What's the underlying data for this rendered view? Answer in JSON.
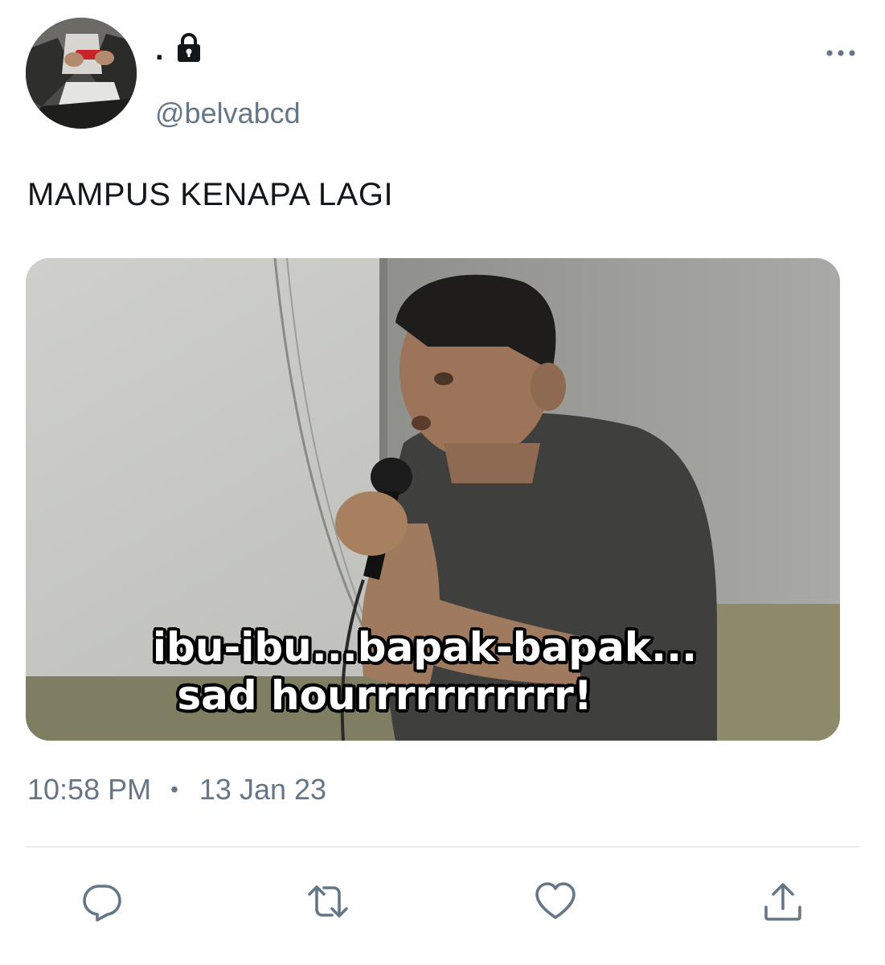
{
  "tweet": {
    "display_name": ".",
    "username": "@belvabcd",
    "text": "MAMPUS KENAPA LAGI",
    "time": "10:58 PM",
    "separator": "•",
    "date": "13 Jan 23",
    "media": {
      "caption_line1": "ibu-ibu...bapak-bapak...",
      "caption_line2": "sad hourrrrrrrrrrr!"
    }
  },
  "icons": {
    "lock": "lock-icon",
    "more": "more-horizontal-icon",
    "reply": "reply-icon",
    "retweet": "retweet-icon",
    "like": "heart-icon",
    "share": "share-icon"
  },
  "colors": {
    "text_primary": "#14171a",
    "text_secondary": "#657786",
    "divider": "#e6ecf0",
    "icon": "#657786"
  }
}
